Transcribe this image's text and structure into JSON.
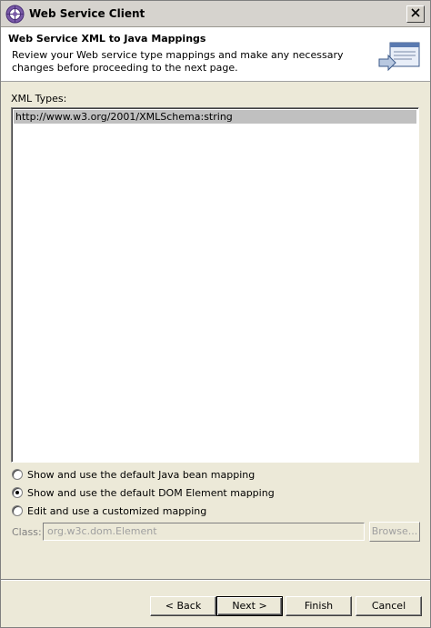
{
  "window": {
    "title": "Web Service Client",
    "app_icon": "eclipse-globe-icon",
    "close_icon": "close-icon"
  },
  "banner": {
    "title": "Web Service XML to Java Mappings",
    "description": "Review your Web service type mappings and make any necessary changes before proceeding to the next page.",
    "icon": "web-service-wizard-icon"
  },
  "xml_types": {
    "label": "XML Types:",
    "items": [
      "http://www.w3.org/2001/XMLSchema:string"
    ],
    "selected_index": 0
  },
  "mapping_options": [
    {
      "label": "Show and use the default Java bean mapping",
      "checked": false
    },
    {
      "label": "Show and use the default DOM Element mapping",
      "checked": true
    },
    {
      "label": "Edit and use a customized mapping",
      "checked": false
    }
  ],
  "class_field": {
    "label": "Class:",
    "value": "org.w3c.dom.Element",
    "enabled": false
  },
  "browse_button": {
    "label": "Browse...",
    "enabled": false
  },
  "buttons": {
    "back": "< Back",
    "next": "Next >",
    "finish": "Finish",
    "cancel": "Cancel"
  }
}
